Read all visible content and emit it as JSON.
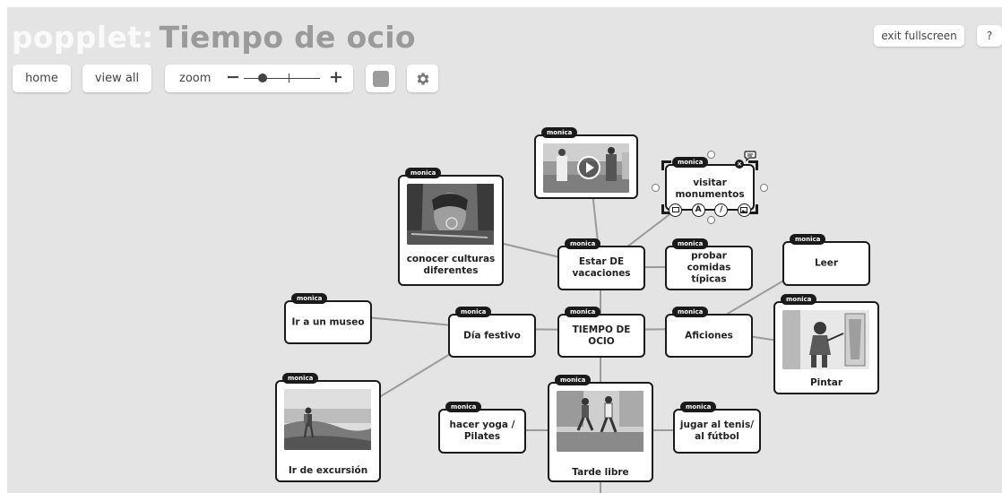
{
  "header": {
    "logo": "popplet:",
    "title": "Tiempo de ocio"
  },
  "toolbar": {
    "home": "home",
    "view_all": "view all",
    "zoom_label": "zoom",
    "zoom_minus": "−",
    "zoom_plus": "+",
    "zoom_level": 0.25,
    "color_swatch": "#9c9c9c",
    "settings_icon": "gear-icon"
  },
  "top_right": {
    "exit_fullscreen": "exit fullscreen",
    "help": "?"
  },
  "author_tag": "monica",
  "nodes": {
    "video": {
      "media": "video-thumbnail"
    },
    "visitar": {
      "text": "visitar monumentos"
    },
    "culturas": {
      "text": "conocer culturas diferentes",
      "caption": ""
    },
    "estar": {
      "text": "Estar DE vacaciones"
    },
    "comidas": {
      "text": "probar comidas típicas"
    },
    "leer": {
      "text": "Leer"
    },
    "museo": {
      "text": "Ir a un museo"
    },
    "festivo": {
      "text": "Día festivo"
    },
    "tiempo": {
      "text": "TIEMPO DE OCIO"
    },
    "aficiones": {
      "text": "Aficiones"
    },
    "pintar": {
      "text": "Pintar"
    },
    "excursion": {
      "text": "Ir de excursión"
    },
    "yoga": {
      "text": "hacer yoga / Pilates"
    },
    "tarde": {
      "text": "Tarde libre"
    },
    "tenis": {
      "text": "jugar al tenis/ al fútbol"
    }
  },
  "editor": {
    "text_tool": "A",
    "draw_tool": "/"
  }
}
